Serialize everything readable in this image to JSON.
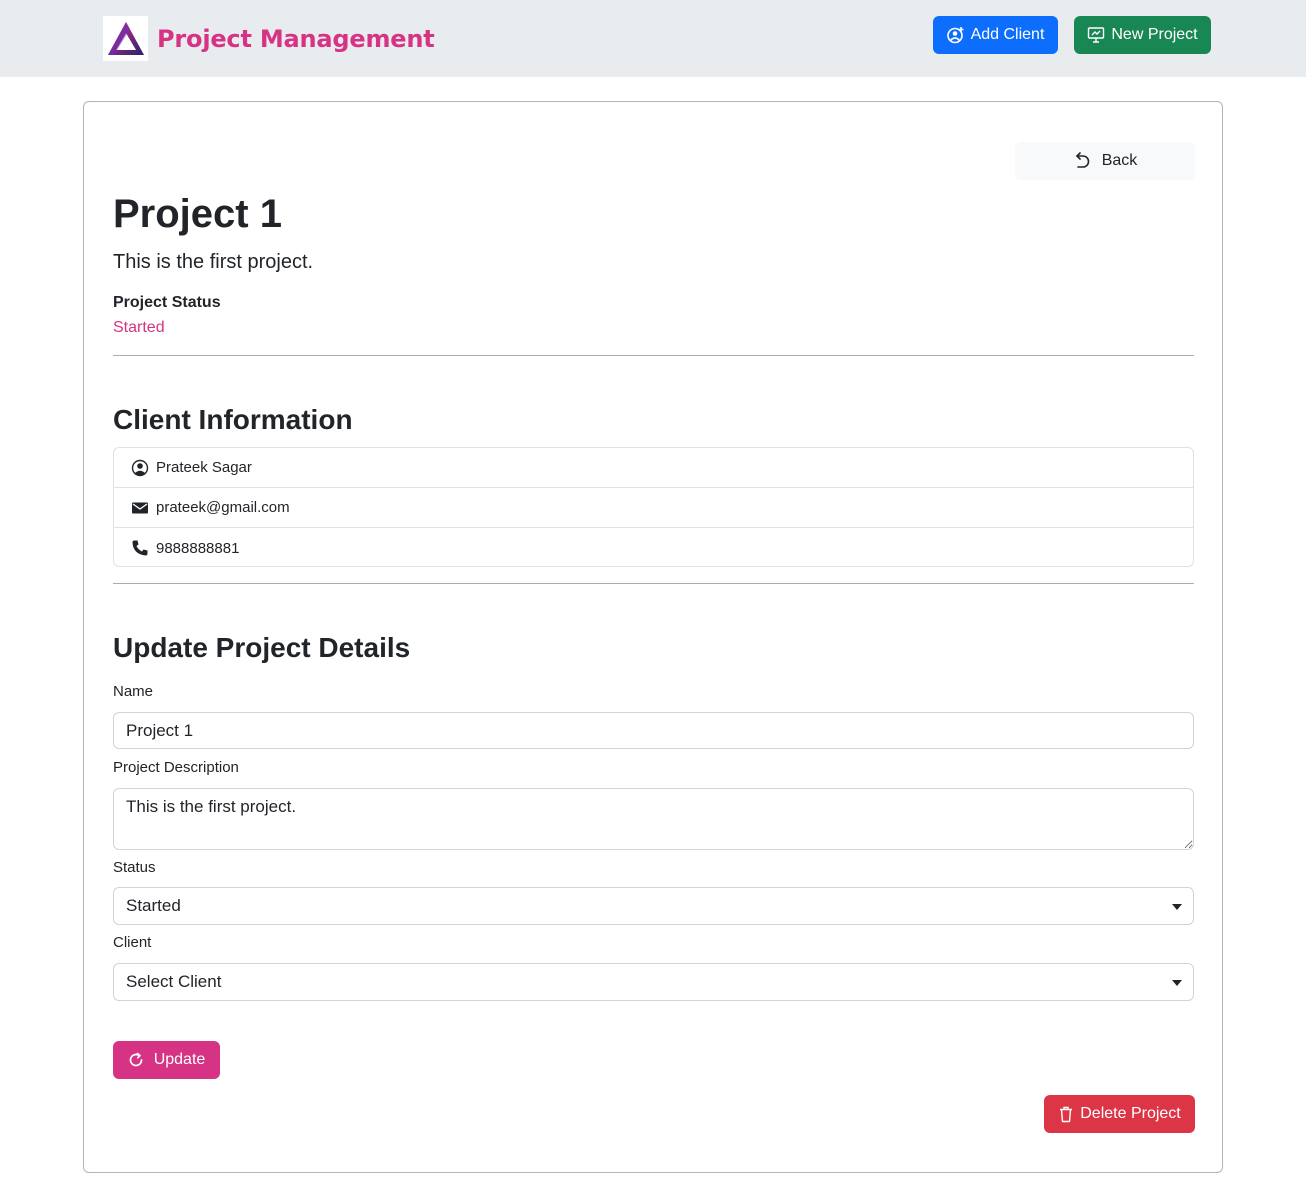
{
  "navbar": {
    "brand": "Project Management",
    "add_client_label": "Add Client",
    "new_project_label": "New Project",
    "colors": {
      "brand": "#d63384",
      "add_client": "#0d6efd",
      "new_project": "#198754"
    }
  },
  "project": {
    "back_label": "Back",
    "name": "Project 1",
    "description": "This is the first project.",
    "status_label": "Project Status",
    "status": "Started"
  },
  "client_info": {
    "heading": "Client Information",
    "name": "Prateek Sagar",
    "email": "prateek@gmail.com",
    "phone": "9888888881",
    "icons": [
      "person-icon",
      "envelope-icon",
      "phone-icon"
    ]
  },
  "update_form": {
    "heading": "Update Project Details",
    "name_label": "Name",
    "name_value": "Project 1",
    "description_label": "Project Description",
    "description_value": "This is the first project.",
    "status_label": "Status",
    "status_value": "Started",
    "client_label": "Client",
    "client_value": "Select Client",
    "update_label": "Update",
    "delete_label": "Delete Project",
    "colors": {
      "update": "#d63384",
      "delete": "#dc3545"
    }
  }
}
